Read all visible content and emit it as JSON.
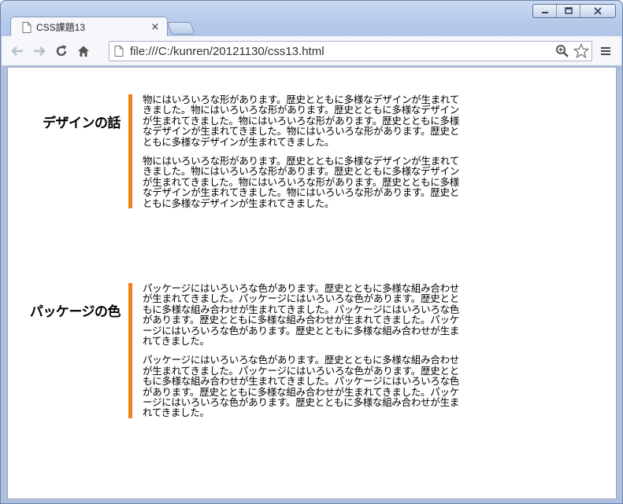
{
  "browser": {
    "tab_title": "CSS課題13",
    "tab_close": "×",
    "url": "file:///C:/kunren/20121130/css13.html"
  },
  "sections": [
    {
      "heading": "デザインの話",
      "paragraphs": [
        "物にはいろいろな形があります。歴史とともに多様なデザインが生まれてきました。物にはいろいろな形があります。歴史とともに多様なデザインが生まれてきました。物にはいろいろな形があります。歴史とともに多様なデザインが生まれてきました。物にはいろいろな形があります。歴史とともに多様なデザインが生まれてきました。",
        "物にはいろいろな形があります。歴史とともに多様なデザインが生まれてきました。物にはいろいろな形があります。歴史とともに多様なデザインが生まれてきました。物にはいろいろな形があります。歴史とともに多様なデザインが生まれてきました。物にはいろいろな形があります。歴史とともに多様なデザインが生まれてきました。"
      ]
    },
    {
      "heading": "パッケージの色",
      "paragraphs": [
        "パッケージにはいろいろな色があります。歴史とともに多様な組み合わせが生まれてきました。パッケージにはいろいろな色があります。歴史とともに多様な組み合わせが生まれてきました。パッケージにはいろいろな色があります。歴史とともに多様な組み合わせが生まれてきました。パッケージにはいろいろな色があります。歴史とともに多様な組み合わせが生まれてきました。",
        "パッケージにはいろいろな色があります。歴史とともに多様な組み合わせが生まれてきました。パッケージにはいろいろな色があります。歴史とともに多様な組み合わせが生まれてきました。パッケージにはいろいろな色があります。歴史とともに多様な組み合わせが生まれてきました。パッケージにはいろいろな色があります。歴史とともに多様な組み合わせが生まれてきました。"
      ]
    }
  ],
  "colors": {
    "accent_border": "#f0801a",
    "frame": "#b4c9ea"
  },
  "icons": {
    "back": "back-arrow-icon",
    "forward": "forward-arrow-icon",
    "reload": "reload-icon",
    "home": "home-icon",
    "zoom": "zoom-icon",
    "bookmark": "star-icon",
    "menu": "menu-icon"
  }
}
